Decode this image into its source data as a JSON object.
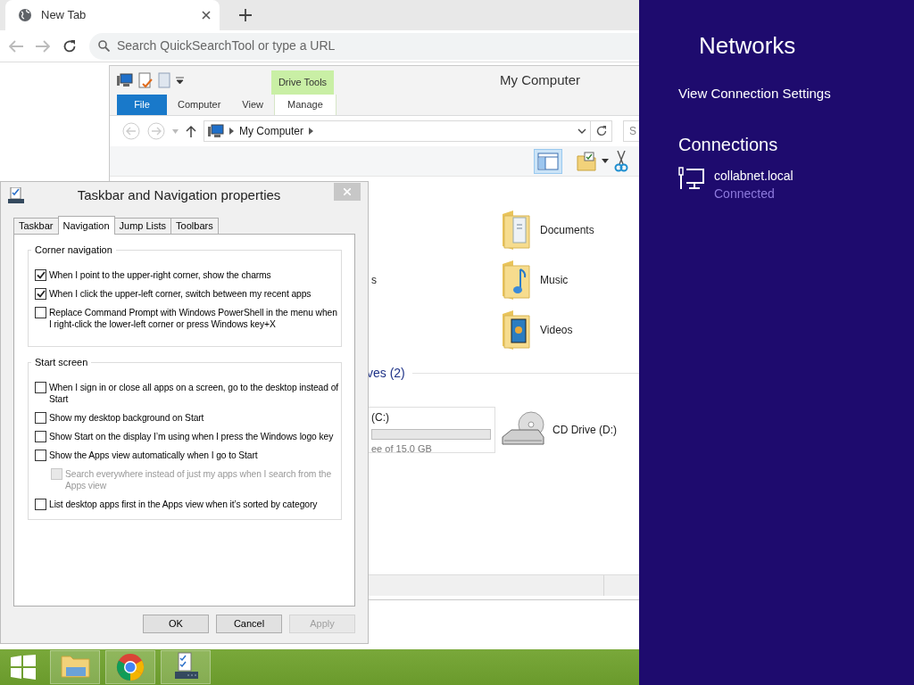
{
  "browser": {
    "tab": {
      "title": "New Tab"
    },
    "address_bar": {
      "placeholder": "Search QuickSearchTool or type a URL"
    }
  },
  "explorer": {
    "title": "My Computer",
    "contextual_group": "Drive Tools",
    "ribbon_tabs": [
      {
        "label": "File",
        "kind": "file"
      },
      {
        "label": "Computer",
        "kind": "tab"
      },
      {
        "label": "View",
        "kind": "tab"
      },
      {
        "label": "Manage",
        "kind": "contextual"
      }
    ],
    "address": {
      "path": "My Computer"
    },
    "search": {
      "placeholder": "S"
    },
    "partial_item": {
      "label": "s"
    },
    "folders": [
      {
        "name": "Documents",
        "kind": "documents"
      },
      {
        "name": "Music",
        "kind": "music"
      },
      {
        "name": "Videos",
        "kind": "videos"
      }
    ],
    "drives_header": "ves (2)",
    "drives": [
      {
        "kind": "disk",
        "label": "(C:)",
        "free": "ee of 15.0 GB"
      },
      {
        "kind": "cd",
        "label": "CD Drive (D:)"
      }
    ]
  },
  "dialog": {
    "title": "Taskbar and Navigation properties",
    "tabs": [
      {
        "label": "Taskbar",
        "selected": false
      },
      {
        "label": "Navigation",
        "selected": true
      },
      {
        "label": "Jump Lists",
        "selected": false
      },
      {
        "label": "Toolbars",
        "selected": false
      }
    ],
    "groups": [
      {
        "title": "Corner navigation",
        "options": [
          {
            "label": "When I point to the upper-right corner, show the charms",
            "checked": true,
            "disabled": false
          },
          {
            "label": "When I click the upper-left corner, switch between my recent apps",
            "checked": true,
            "disabled": false
          },
          {
            "label": "Replace Command Prompt with Windows PowerShell in the menu when I right-click the lower-left corner or press Windows key+X",
            "checked": false,
            "disabled": false
          }
        ]
      },
      {
        "title": "Start screen",
        "options": [
          {
            "label": "When I sign in or close all apps on a screen, go to the desktop instead of Start",
            "checked": false,
            "disabled": false
          },
          {
            "label": "Show my desktop background on Start",
            "checked": false,
            "disabled": false
          },
          {
            "label": "Show Start on the display I’m using when I press the Windows logo key",
            "checked": false,
            "disabled": false
          },
          {
            "label": "Show the Apps view automatically when I go to Start",
            "checked": false,
            "disabled": false,
            "children": [
              {
                "label": "Search everywhere instead of just my apps when I search from the Apps view",
                "checked": false,
                "disabled": true
              }
            ]
          },
          {
            "label": "List desktop apps first in the Apps view when it’s sorted by category",
            "checked": false,
            "disabled": false
          }
        ]
      }
    ],
    "buttons": [
      {
        "label": "OK",
        "disabled": false
      },
      {
        "label": "Cancel",
        "disabled": false
      },
      {
        "label": "Apply",
        "disabled": true
      }
    ]
  },
  "taskbar": {
    "apps": [
      {
        "kind": "explorer"
      },
      {
        "kind": "chrome"
      },
      {
        "kind": "properties"
      }
    ]
  },
  "charms": {
    "title": "Networks",
    "link": "View Connection Settings",
    "section": "Connections",
    "connections": [
      {
        "name": "collabnet.local",
        "status": "Connected"
      }
    ]
  }
}
